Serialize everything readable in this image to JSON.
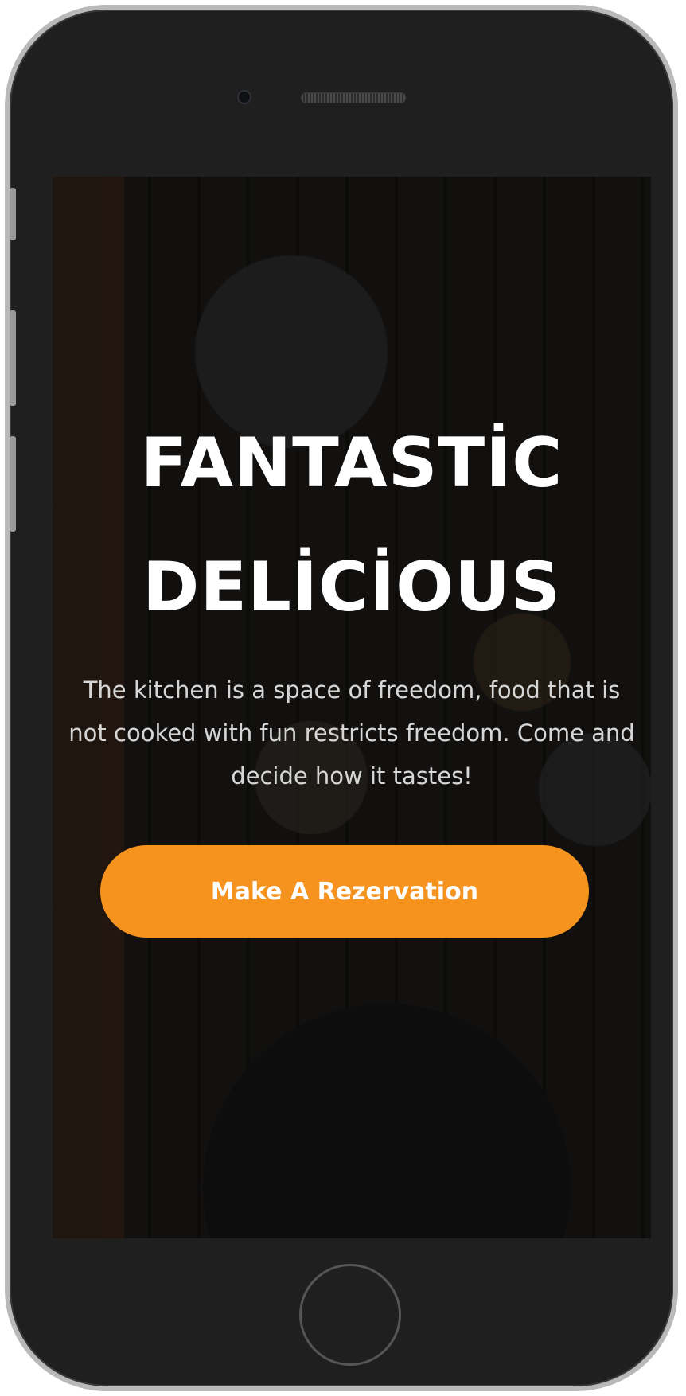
{
  "hero": {
    "title_line1": "FANTASTİC",
    "title_line2": "DELİCİOUS",
    "description": "The kitchen is a space of freedom, food that is not cooked with fun restricts freedom. Come and decide how it tastes!",
    "cta_label": "Make A Rezervation"
  },
  "colors": {
    "accent": "#f6921e",
    "device_body": "#1f1f1f",
    "device_frame": "#b9b9b9"
  }
}
